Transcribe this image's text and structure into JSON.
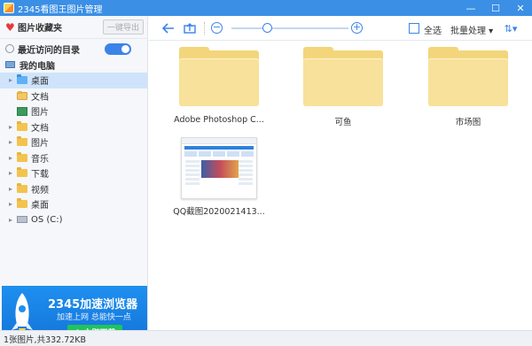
{
  "window": {
    "title": "2345看图王图片管理",
    "controls": [
      "minimize-icon",
      "maximize-icon",
      "close-icon"
    ]
  },
  "sidebar": {
    "favorites_label": "图片收藏夹",
    "export_label": "一键导出",
    "recent_label": "最近访问的目录",
    "recent_toggle_on": true,
    "my_computer_label": "我的电脑",
    "tree": [
      {
        "label": "桌面",
        "icon": "folder-blue-icon",
        "expand": "▸",
        "selected": true
      },
      {
        "label": "文档",
        "icon": "folder-doc-icon",
        "expand": "",
        "selected": false
      },
      {
        "label": "图片",
        "icon": "image-icon",
        "expand": "",
        "selected": false
      },
      {
        "label": "文档",
        "icon": "folder-icon",
        "expand": "▸",
        "selected": false
      },
      {
        "label": "图片",
        "icon": "folder-icon",
        "expand": "▸",
        "selected": false
      },
      {
        "label": "音乐",
        "icon": "folder-icon",
        "expand": "▸",
        "selected": false
      },
      {
        "label": "下载",
        "icon": "folder-icon",
        "expand": "▸",
        "selected": false
      },
      {
        "label": "视频",
        "icon": "folder-icon",
        "expand": "▸",
        "selected": false
      },
      {
        "label": "桌面",
        "icon": "folder-icon",
        "expand": "▸",
        "selected": false
      },
      {
        "label": "OS (C:)",
        "icon": "drive-icon",
        "expand": "▸",
        "selected": false
      }
    ]
  },
  "ad": {
    "title": "2345加速浏览器",
    "subtitle": "加速上网 总能快一点",
    "button": "⬇ 立即下载"
  },
  "toolbar": {
    "select_all": "全选",
    "batch": "批量处理 ▾",
    "sort_icon": "sort-icon",
    "zoom_level": 0.3
  },
  "content": {
    "items": [
      {
        "label": "Adobe Photoshop C...",
        "type": "folder"
      },
      {
        "label": "可鱼",
        "type": "folder"
      },
      {
        "label": "市场图",
        "type": "folder"
      },
      {
        "label": "QQ截图2020021413...",
        "type": "image"
      }
    ]
  },
  "status": {
    "text": "1张图片,共332.72KB"
  },
  "colors": {
    "accent": "#3a84e8",
    "titlebar": "#3b8fe5",
    "folder": "#f3d57b",
    "download_button": "#21c35c"
  }
}
